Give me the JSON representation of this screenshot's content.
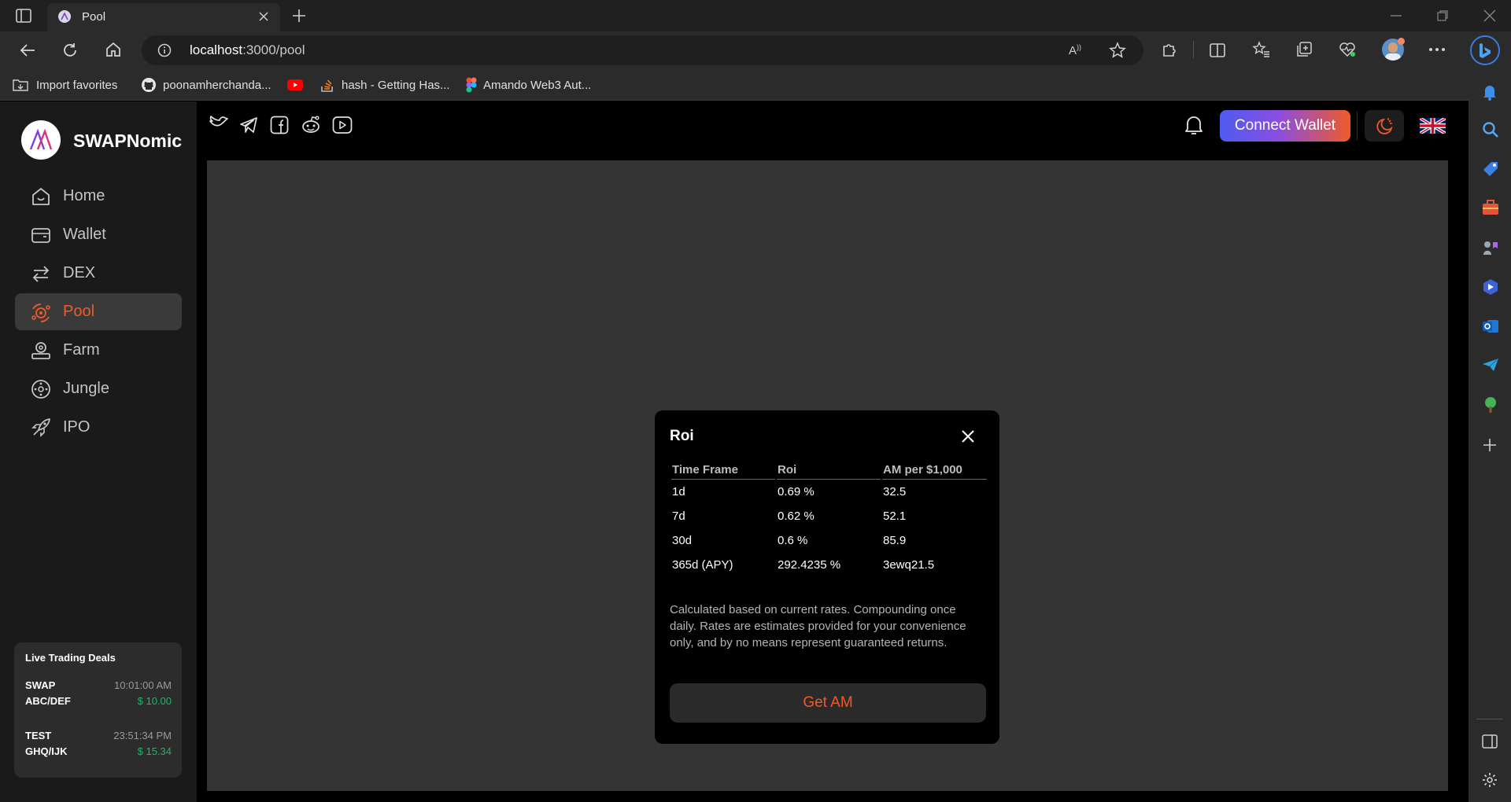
{
  "browser": {
    "tab_title": "Pool",
    "url_host": "localhost",
    "url_path": ":3000/pool",
    "favorites": [
      "Import favorites",
      "poonamherchanda...",
      "hash - Getting Has...",
      "Amando Web3 Aut..."
    ]
  },
  "app": {
    "brand": "SWAPNomic",
    "nav": [
      {
        "label": "Home",
        "icon": "home-icon"
      },
      {
        "label": "Wallet",
        "icon": "wallet-icon"
      },
      {
        "label": "DEX",
        "icon": "swap-arrows-icon"
      },
      {
        "label": "Pool",
        "icon": "pool-icon",
        "active": true
      },
      {
        "label": "Farm",
        "icon": "farm-icon"
      },
      {
        "label": "Jungle",
        "icon": "jungle-icon"
      },
      {
        "label": "IPO",
        "icon": "rocket-icon"
      }
    ],
    "connect_wallet": "Connect Wallet",
    "accent_color": "#f05a28",
    "live_deals": {
      "title": "Live Trading Deals",
      "deals": [
        {
          "name": "SWAP",
          "pair": "ABC/DEF",
          "time": "10:01:00 AM",
          "price": "$ 10.00"
        },
        {
          "name": "TEST",
          "pair": "GHQ/IJK",
          "time": "23:51:34 PM",
          "price": "$ 15.34"
        }
      ]
    }
  },
  "modal": {
    "title": "Roi",
    "columns": [
      "Time Frame",
      "Roi",
      "AM per $1,000"
    ],
    "rows": [
      [
        "1d",
        "0.69 %",
        "32.5"
      ],
      [
        "7d",
        "0.62 %",
        "52.1"
      ],
      [
        "30d",
        "0.6 %",
        "85.9"
      ],
      [
        "365d (APY)",
        "292.4235 %",
        "3ewq21.5"
      ]
    ],
    "note": "Calculated based on current rates. Compounding once daily. Rates are estimates provided for your convenience only, and by no means represent guaranteed returns.",
    "button": "Get AM"
  }
}
